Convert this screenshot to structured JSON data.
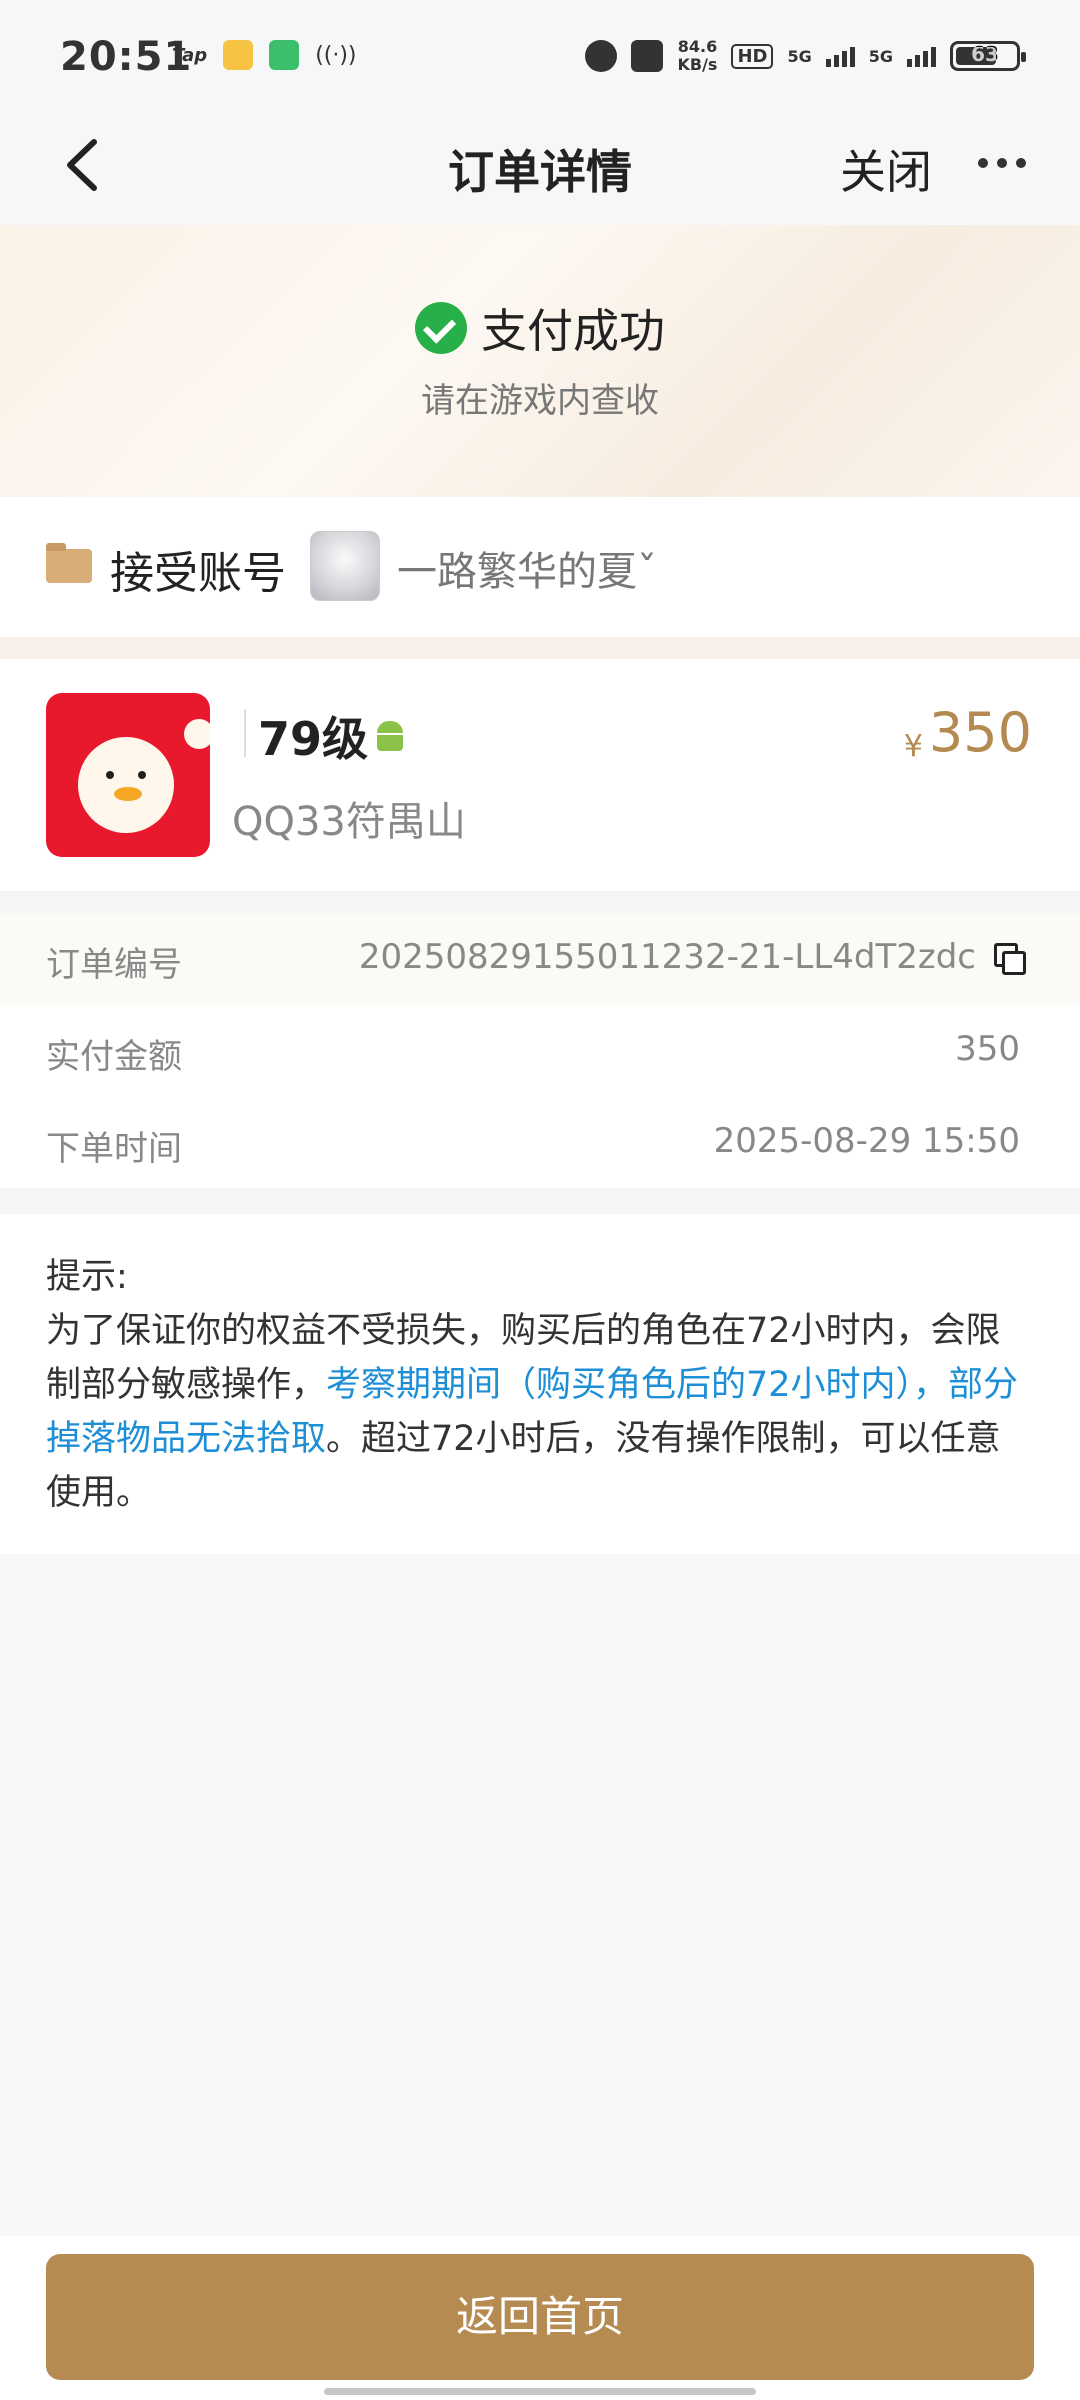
{
  "status_bar": {
    "time": "20:51",
    "app_icons": [
      "tap-icon",
      "weibo-icon",
      "game-app-icon",
      "radio-icon"
    ],
    "tap_label": "Tap",
    "net_speed_value": "84.6",
    "net_speed_unit": "KB/s",
    "hd_badge": "HD",
    "sim1": "5G",
    "sim2": "5G",
    "battery": "63"
  },
  "nav": {
    "title": "订单详情",
    "close_label": "关闭"
  },
  "success": {
    "title": "支付成功",
    "subtitle": "请在游戏内查收"
  },
  "account": {
    "label": "接受账号",
    "name": "一路繁华的夏ˇ"
  },
  "product": {
    "level": "79级",
    "server": "QQ33符禺山",
    "currency_symbol": "¥",
    "price": "350"
  },
  "order": {
    "rows": [
      {
        "label": "订单编号",
        "value": "20250829155011232-21-LL4dT2zdc"
      },
      {
        "label": "实付金额",
        "value": "350"
      },
      {
        "label": "下单时间",
        "value": "2025-08-29 15:50"
      }
    ]
  },
  "tips": {
    "title": "提示:",
    "text_before": "为了保证你的权益不受损失，购买后的角色在72小时内，会限制部分敏感操作，",
    "text_highlight": "考察期期间（购买角色后的72小时内），部分掉落物品无法拾取",
    "text_after": "。超过72小时后，没有操作限制，可以任意使用。",
    "highlight_color": "#1e8fd6"
  },
  "bottom": {
    "home_button_label": "返回首页",
    "button_color": "#b68b52"
  },
  "colors": {
    "accent_gold": "#b48a52",
    "success_green": "#27b04a"
  }
}
